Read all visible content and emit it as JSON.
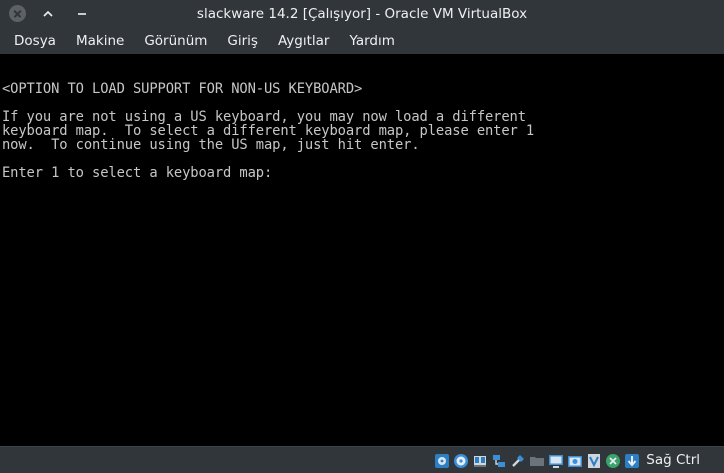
{
  "window": {
    "title": "slackware 14.2 [Çalışıyor] - Oracle VM VirtualBox",
    "accent": "#31363b"
  },
  "menu": {
    "items": [
      {
        "label": "Dosya"
      },
      {
        "label": "Makine"
      },
      {
        "label": "Görünüm"
      },
      {
        "label": "Giriş"
      },
      {
        "label": "Aygıtlar"
      },
      {
        "label": "Yardım"
      }
    ]
  },
  "console": {
    "lines": [
      "<OPTION TO LOAD SUPPORT FOR NON-US KEYBOARD>",
      "If you are not using a US keyboard, you may now load a different",
      "keyboard map.  To select a different keyboard map, please enter 1",
      "now.  To continue using the US map, just hit enter.",
      "Enter 1 to select a keyboard map:"
    ],
    "text_color": "#c6c6c6",
    "background": "#000000"
  },
  "statusbar": {
    "icons": [
      "hard-disk-icon",
      "optical-drive-icon",
      "audio-icon",
      "network-icon",
      "usb-icon",
      "shared-folders-icon",
      "display-icon",
      "video-capture-icon",
      "virtualization-icon",
      "mouse-integration-icon",
      "keyboard-capture-icon"
    ],
    "host_key": "Sağ Ctrl"
  }
}
